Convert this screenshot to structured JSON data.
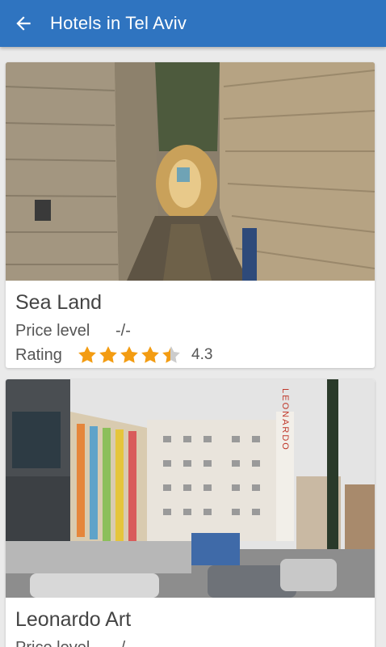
{
  "appbar": {
    "title": "Hotels in Tel Aviv",
    "back_icon": "arrow-left-icon"
  },
  "colors": {
    "appbar": "#2f74c0",
    "star": "#f39c12",
    "star_empty": "#cccccc"
  },
  "hotels": [
    {
      "name": "Sea Land",
      "price_label": "Price level",
      "price_value": "-/-",
      "rating_label": "Rating",
      "rating_value": "4.3",
      "stars": 4.3
    },
    {
      "name": "Leonardo Art",
      "price_label": "Price level",
      "price_value": "-/-"
    }
  ],
  "sign_text": "LEONARDO"
}
